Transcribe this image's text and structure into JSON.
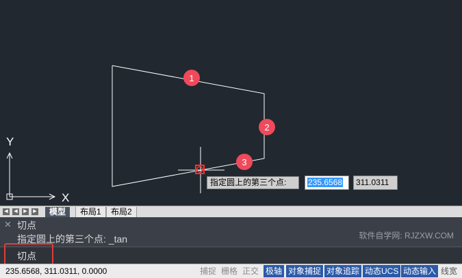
{
  "tooltip": {
    "prompt": "指定圆上的第三个点:",
    "x_value": "235.6568",
    "y_value": "311.0311"
  },
  "markers": [
    "1",
    "2",
    "3"
  ],
  "axes": {
    "y_label": "Y",
    "x_label": "X"
  },
  "tabs": {
    "model": "模型",
    "layout1": "布局1",
    "layout2": "布局2"
  },
  "command": {
    "line1": "切点",
    "line2": "指定圆上的第三个点: _tan",
    "input": "切点",
    "watermark": "软件自学网: RJZXW.COM"
  },
  "status": {
    "coords": "235.6568, 311.0311, 0.0000",
    "buttons": [
      {
        "label": "捕捉",
        "state": "off"
      },
      {
        "label": "栅格",
        "state": "off"
      },
      {
        "label": "正交",
        "state": "off"
      },
      {
        "label": "极轴",
        "state": "on"
      },
      {
        "label": "对象捕捉",
        "state": "on"
      },
      {
        "label": "对象追踪",
        "state": "on"
      },
      {
        "label": "动态UCS",
        "state": "on"
      },
      {
        "label": "动态输入",
        "state": "on"
      },
      {
        "label": "线宽",
        "state": "plain"
      }
    ]
  },
  "colors": {
    "canvas_bg": "#212830",
    "marker_red": "#ef4a5c",
    "highlight_border": "#e23b3b",
    "active_button": "#2b5aa8",
    "selection": "#3399ff"
  }
}
